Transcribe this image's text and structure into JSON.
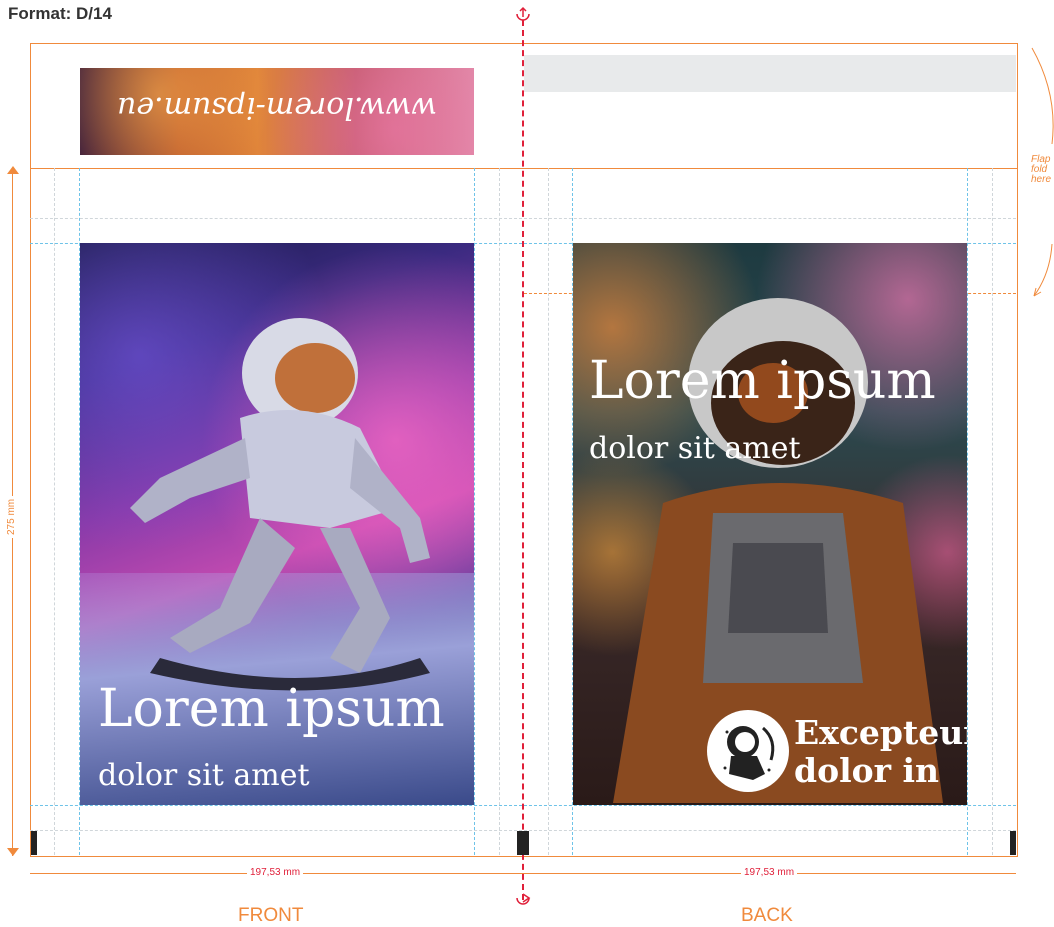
{
  "header": {
    "format_label": "Format: D/14"
  },
  "flap": {
    "url_text": "www.lorem-ipsum.eu",
    "note_line1": "Flap",
    "note_line2": "fold",
    "note_line3": "here"
  },
  "front": {
    "title": "Lorem ipsum",
    "subtitle": "dolor sit amet",
    "width_label": "197,53 mm",
    "panel_label": "FRONT"
  },
  "back": {
    "title": "Lorem ipsum",
    "subtitle": "dolor sit amet",
    "logo_line1": "Excepteur",
    "logo_line2": "dolor in",
    "width_label": "197,53 mm",
    "panel_label": "BACK"
  },
  "height_label": "275 mm",
  "colors": {
    "guide_orange": "#f08a3c",
    "fold_red": "#e0203a",
    "bleed_blue": "#6ec3e8"
  }
}
